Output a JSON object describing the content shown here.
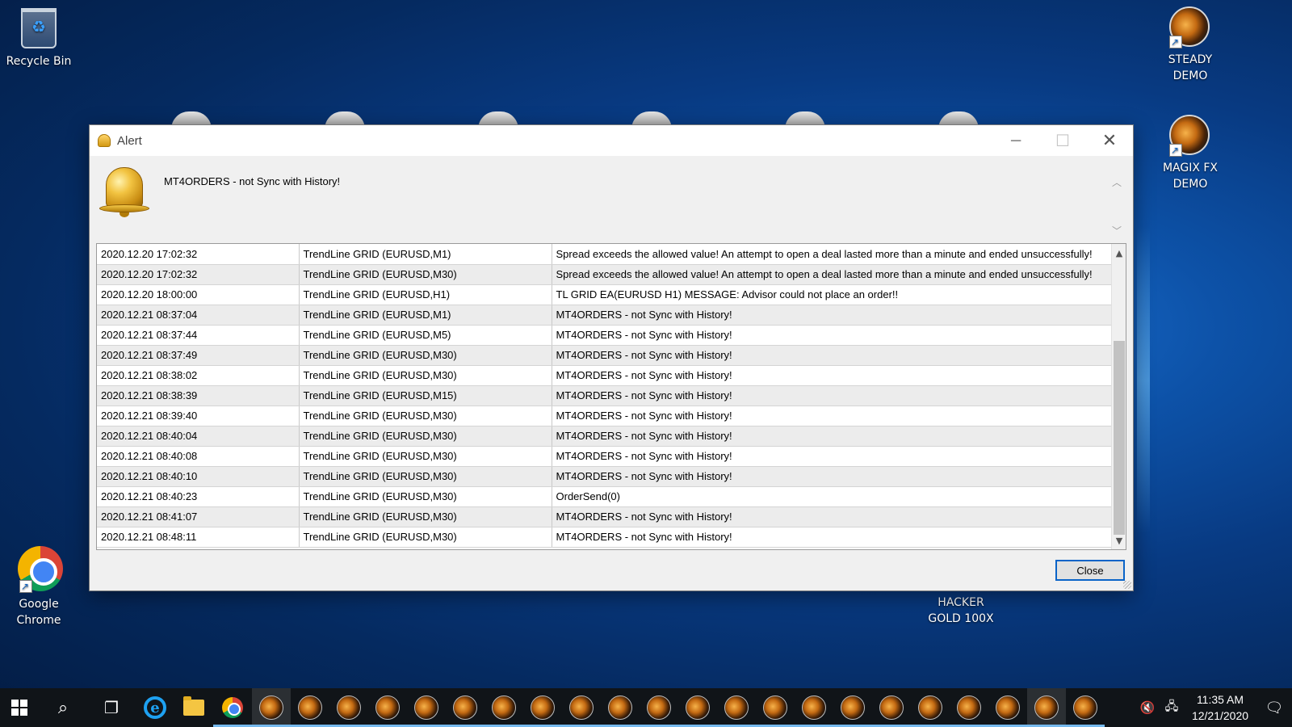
{
  "desktop": {
    "icons": [
      {
        "label": "Recycle Bin",
        "icon": "recycle-bin-icon"
      },
      {
        "label": "STEADY DEMO",
        "icon": "bull-app-icon"
      },
      {
        "label": "MAGIX FX DEMO",
        "icon": "bull-app-icon"
      },
      {
        "label": "Google Chrome",
        "icon": "chrome-icon"
      },
      {
        "label": "HACKER GOLD 100X",
        "icon": "bull-app-icon"
      }
    ]
  },
  "window": {
    "title": "Alert",
    "controls": {
      "minimize": "─",
      "maximize": "☐",
      "close": "✕"
    },
    "message": "MT4ORDERS - not Sync with History!",
    "close_button": "Close",
    "rows": [
      [
        "2020.12.20 17:02:32",
        "TrendLine GRID (EURUSD,M1)",
        "Spread exceeds the allowed value! An attempt to open a deal lasted more than a minute and ended unsuccessfully!"
      ],
      [
        "2020.12.20 17:02:32",
        "TrendLine GRID (EURUSD,M30)",
        "Spread exceeds the allowed value! An attempt to open a deal lasted more than a minute and ended unsuccessfully!"
      ],
      [
        "2020.12.20 18:00:00",
        "TrendLine GRID (EURUSD,H1)",
        "TL GRID EA(EURUSD H1) MESSAGE: Advisor could not place an order!!"
      ],
      [
        "2020.12.21 08:37:04",
        "TrendLine GRID (EURUSD,M1)",
        "MT4ORDERS - not Sync with History!"
      ],
      [
        "2020.12.21 08:37:44",
        "TrendLine GRID (EURUSD,M5)",
        "MT4ORDERS - not Sync with History!"
      ],
      [
        "2020.12.21 08:37:49",
        "TrendLine GRID (EURUSD,M30)",
        "MT4ORDERS - not Sync with History!"
      ],
      [
        "2020.12.21 08:38:02",
        "TrendLine GRID (EURUSD,M30)",
        "MT4ORDERS - not Sync with History!"
      ],
      [
        "2020.12.21 08:38:39",
        "TrendLine GRID (EURUSD,M15)",
        "MT4ORDERS - not Sync with History!"
      ],
      [
        "2020.12.21 08:39:40",
        "TrendLine GRID (EURUSD,M30)",
        "MT4ORDERS - not Sync with History!"
      ],
      [
        "2020.12.21 08:40:04",
        "TrendLine GRID (EURUSD,M30)",
        "MT4ORDERS - not Sync with History!"
      ],
      [
        "2020.12.21 08:40:08",
        "TrendLine GRID (EURUSD,M30)",
        "MT4ORDERS - not Sync with History!"
      ],
      [
        "2020.12.21 08:40:10",
        "TrendLine GRID (EURUSD,M30)",
        "MT4ORDERS - not Sync with History!"
      ],
      [
        "2020.12.21 08:40:23",
        "TrendLine GRID (EURUSD,M30)",
        "OrderSend(0)"
      ],
      [
        "2020.12.21 08:41:07",
        "TrendLine GRID (EURUSD,M30)",
        "MT4ORDERS - not Sync with History!"
      ],
      [
        "2020.12.21 08:48:11",
        "TrendLine GRID (EURUSD,M30)",
        "MT4ORDERS - not Sync with History!"
      ]
    ]
  },
  "taskbar": {
    "clock_time": "11:35 AM",
    "clock_date": "12/21/2020"
  }
}
